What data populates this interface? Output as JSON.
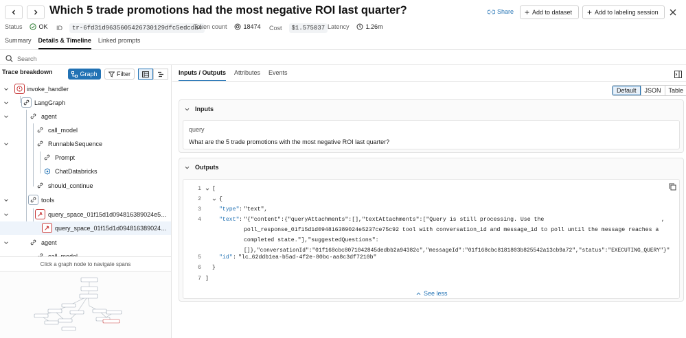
{
  "header": {
    "title": "Which 5 trade promotions had the most negative ROI last quarter?",
    "share_label": "Share",
    "add_dataset_label": "Add to dataset",
    "add_labeling_label": "Add to labeling session"
  },
  "meta": {
    "status_label": "Status",
    "status_value": "OK",
    "id_label": "ID",
    "id_value": "tr-6fd31d9635605426730129dfc5edcda4",
    "token_label": "Token count",
    "token_value": "18474",
    "cost_label": "Cost",
    "cost_value": "$1.575037",
    "latency_label": "Latency",
    "latency_value": "1.26m"
  },
  "tabs": [
    "Summary",
    "Details & Timeline",
    "Linked prompts"
  ],
  "search": {
    "placeholder": "Search"
  },
  "left": {
    "title": "Trace breakdown",
    "graph_label": "Graph",
    "filter_label": "Filter",
    "hint": "Click a graph node to navigate spans",
    "tree": [
      {
        "label": "invoke_handler"
      },
      {
        "label": "LangGraph"
      },
      {
        "label": "agent"
      },
      {
        "label": "call_model"
      },
      {
        "label": "RunnableSequence"
      },
      {
        "label": "Prompt"
      },
      {
        "label": "ChatDatabricks"
      },
      {
        "label": "should_continue"
      },
      {
        "label": "tools"
      },
      {
        "label": "query_space_01f15d1d094816389024e52..."
      },
      {
        "label": "query_space_01f15d1d094816389024e..."
      },
      {
        "label": "agent"
      },
      {
        "label": "call_model"
      }
    ]
  },
  "right": {
    "tabs": [
      "Inputs / Outputs",
      "Attributes",
      "Events"
    ],
    "view_options": [
      "Default",
      "JSON",
      "Table"
    ],
    "inputs": {
      "title": "Inputs",
      "key": "query",
      "value": "What are the 5 trade promotions with the most negative ROI last quarter?"
    },
    "outputs": {
      "title": "Outputs",
      "line_numbers": [
        "1",
        "2",
        "3",
        "4",
        "5",
        "6",
        "7"
      ],
      "l1": "[",
      "l2": "{",
      "type_key": "\"type\"",
      "type_val": "\"text\",",
      "text_key": "\"text\"",
      "text_val_1": "\"{\"content\":{\"queryAttachments\":[],\"textAttachments\":[\"Query is still processing. Use the",
      "text_val_1_end": ",",
      "text_val_2": "poll_response_01f15d1d094816389024e5237ce75c92 tool with conversation_id and message_id to poll until the message reaches a",
      "text_val_3": "completed state.\"],\"suggestedQuestions\":",
      "text_val_4": "[]},\"conversationId\":\"01f168cbc8071042845dedbb2a94382c\",\"messageId\":\"01f168cbc8181803b825542a13cb9a72\",\"status\":\"EXECUTING_QUERY\"}\"",
      "id_key": "\"id\"",
      "id_val": "\"lc_62ddb1ea-b5ad-4f2e-80bc-aa8c3df7210b\"",
      "l6": "}",
      "l7": "]",
      "see_less": "See less"
    }
  },
  "colors": {
    "accent": "#2272b4",
    "ok": "#2e7d32",
    "error_icon": "#c83a3a"
  }
}
